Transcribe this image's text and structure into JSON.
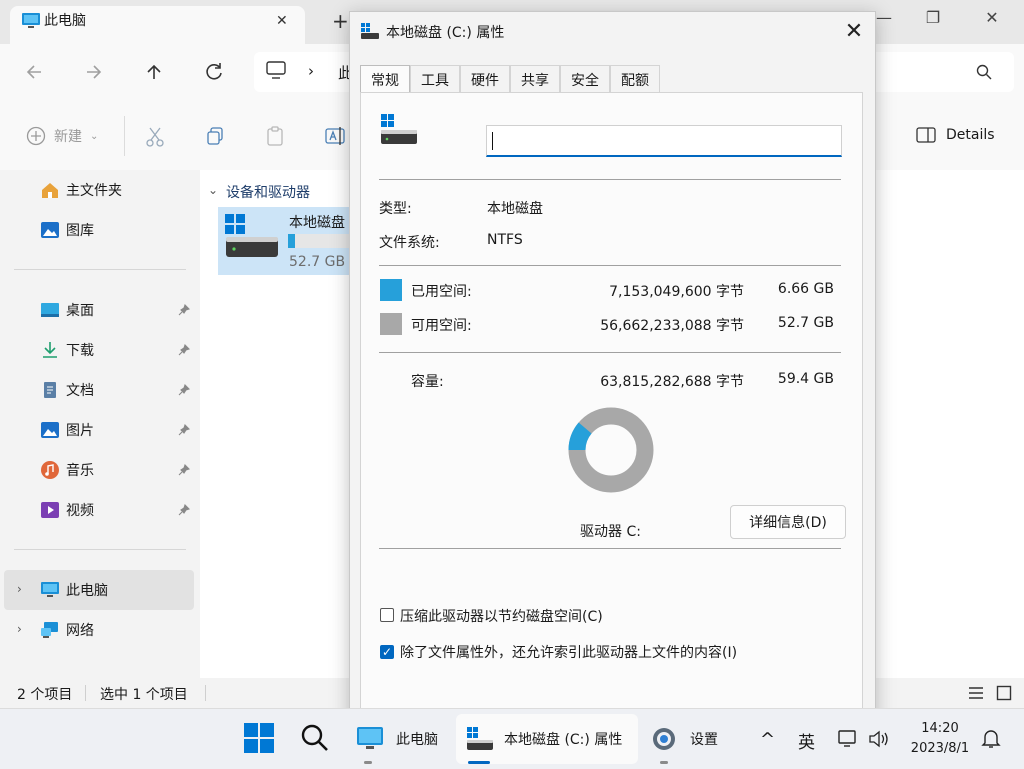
{
  "explorer": {
    "tab_title": "此电脑",
    "new_tab": "+",
    "win_minimize": "—",
    "win_restore": "❐",
    "win_close": "✕",
    "tab_close": "✕",
    "address_prefix": "此",
    "new_button": "新建",
    "details_button": "Details",
    "nav": {
      "home": "主文件夹",
      "gallery": "图库",
      "desktop": "桌面",
      "downloads": "下载",
      "documents": "文档",
      "pictures": "图片",
      "music": "音乐",
      "videos": "视频",
      "this_pc": "此电脑",
      "network": "网络"
    },
    "section_header": "设备和驱动器",
    "drive_name": "本地磁盘",
    "drive_free": "52.7 GB",
    "drive_usage_fraction": 0.117,
    "status_items": "2 个项目",
    "status_selected": "选中 1 个项目"
  },
  "dialog": {
    "title": "本地磁盘 (C:) 属性",
    "close": "✕",
    "tabs": [
      "常规",
      "工具",
      "硬件",
      "共享",
      "安全",
      "配额"
    ],
    "name_value": "",
    "type_label": "类型:",
    "type_value": "本地磁盘",
    "fs_label": "文件系统:",
    "fs_value": "NTFS",
    "used_label": "已用空间:",
    "used_bytes": "7,153,049,600 字节",
    "used_gb": "6.66 GB",
    "free_label": "可用空间:",
    "free_bytes": "56,662,233,088 字节",
    "free_gb": "52.7 GB",
    "capacity_label": "容量:",
    "capacity_bytes": "63,815,282,688 字节",
    "capacity_gb": "59.4 GB",
    "used_fraction": 0.112,
    "used_color": "#26a0da",
    "free_color": "#a8a8a8",
    "drive_label": "驱动器 C:",
    "details_button": "详细信息(D)",
    "compress_label": "压缩此驱动器以节约磁盘空间(C)",
    "compress_checked": false,
    "index_label": "除了文件属性外，还允许索引此驱动器上文件的内容(I)",
    "index_checked": true,
    "check_mark": "✓"
  },
  "taskbar": {
    "this_pc": "此电脑",
    "properties": "本地磁盘 (C:) 属性",
    "settings": "设置",
    "chevron": "^",
    "ime": "英",
    "time": "14:20",
    "date": "2023/8/1"
  }
}
